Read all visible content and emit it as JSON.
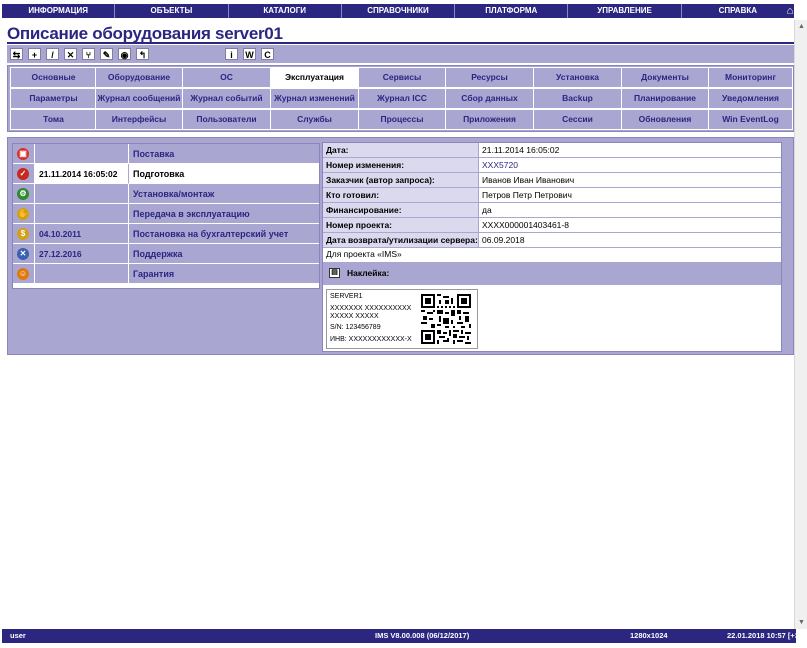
{
  "topnav": {
    "items": [
      "ИНФОРМАЦИЯ",
      "ОБЪЕКТЫ",
      "КАТАЛОГИ",
      "СПРАВОЧНИКИ",
      "ПЛАТФОРМА",
      "УПРАВЛЕНИЕ",
      "СПРАВКА"
    ],
    "home_icon": "home-icon"
  },
  "page": {
    "title": "Описание оборудования server01"
  },
  "toolbar": {
    "buttons": [
      {
        "icon": "refresh-icon",
        "glyph": "⇆"
      },
      {
        "icon": "add-icon",
        "glyph": "+"
      },
      {
        "icon": "edit-icon",
        "glyph": "/"
      },
      {
        "icon": "delete-icon",
        "glyph": "✕"
      },
      {
        "icon": "fork-icon",
        "glyph": "⑂"
      },
      {
        "icon": "pen-icon",
        "glyph": "✎"
      },
      {
        "icon": "binoculars-icon",
        "glyph": "◉"
      },
      {
        "icon": "back-icon",
        "glyph": "↰"
      },
      {
        "icon": "info-icon",
        "glyph": "i"
      },
      {
        "icon": "word-icon",
        "glyph": "W"
      },
      {
        "icon": "csv-icon",
        "glyph": "C"
      }
    ]
  },
  "tabs": {
    "row1": [
      "Основные",
      "Оборудование",
      "ОС",
      "Эксплуатация",
      "Сервисы",
      "Ресурсы",
      "Установка",
      "Документы",
      "Мониторинг"
    ],
    "row2": [
      "Параметры",
      "Журнал сообщений",
      "Журнал событий",
      "Журнал изменений",
      "Журнал ICC",
      "Сбор данных",
      "Backup",
      "Планирование",
      "Уведомления"
    ],
    "row3": [
      "Тома",
      "Интерфейсы",
      "Пользователи",
      "Службы",
      "Процессы",
      "Приложения",
      "Сессии",
      "Обновления",
      "Win EventLog"
    ],
    "active": "Эксплуатация"
  },
  "lifecycle": [
    {
      "icon": "cart-icon",
      "color": "#d9302a",
      "glyph": "🛒",
      "date": "",
      "label": "Поставка"
    },
    {
      "icon": "check-icon",
      "color": "#c8281e",
      "glyph": "✓",
      "date": "21.11.2014 16:05:02",
      "label": "Подготовка"
    },
    {
      "icon": "install-icon",
      "color": "#2e8b2e",
      "glyph": "⚙",
      "date": "",
      "label": "Установка/монтаж"
    },
    {
      "icon": "handover-icon",
      "color": "#d4a017",
      "glyph": "✋",
      "date": "",
      "label": "Передача в эксплуатацию"
    },
    {
      "icon": "accounting-icon",
      "color": "#d4a017",
      "glyph": "$",
      "date": "04.10.2011",
      "label": "Постановка на бухгалтерский учет"
    },
    {
      "icon": "tools-icon",
      "color": "#3c5fb0",
      "glyph": "✕",
      "date": "27.12.2016",
      "label": "Поддержка"
    },
    {
      "icon": "warranty-icon",
      "color": "#e07a10",
      "glyph": "☺",
      "date": "",
      "label": "Гарантия"
    }
  ],
  "details": {
    "rows": [
      {
        "key": "Дата:",
        "value": "21.11.2014 16:05:02",
        "link": false
      },
      {
        "key": "Номер изменения:",
        "value": "XXX5720",
        "link": true
      },
      {
        "key": "Заказчик (автор запроса):",
        "value": "Иванов Иван Иванович",
        "link": false
      },
      {
        "key": "Кто готовил:",
        "value": "Петров Петр Петрович",
        "link": false
      },
      {
        "key": "Финансирование:",
        "value": "да",
        "link": false
      },
      {
        "key": "Номер проекта:",
        "value": "XXXX000001403461-8",
        "link": false
      },
      {
        "key": "Дата возврата/утилизации сервера:",
        "value": "06.09.2018",
        "link": false
      }
    ],
    "note": "Для проекта «IMS»",
    "sticker_label": "Наклейка:",
    "sticker": {
      "line1": "SERVER1",
      "line2": "XXXXXXX XXXXXXXXXX XXXXX XXXXX",
      "line3": "S/N: 123456789",
      "line4": "ИНВ: XXXXXXXXXXXX-X"
    }
  },
  "statusbar": {
    "user": "user",
    "version": "IMS V8.00.008 (06/12/2017)",
    "resolution": "1280x1024",
    "datetime": "22.01.2018 10:57 [+3]"
  }
}
